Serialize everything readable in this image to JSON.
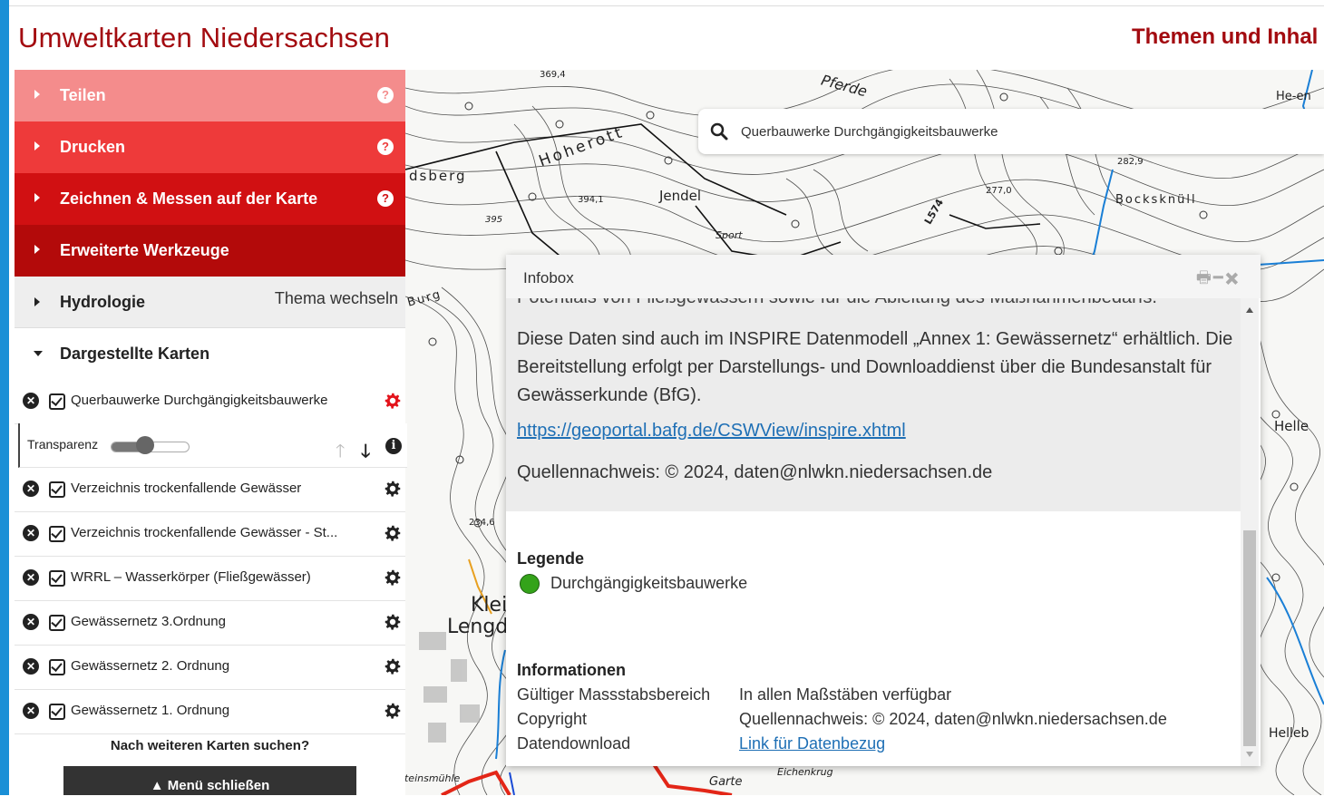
{
  "app": {
    "title": "Umweltkarten Niedersachsen",
    "themes_link": "Themen und Inhal"
  },
  "search": {
    "value": "Querbauwerke Durchgängigkeitsbauwerke"
  },
  "sidebar": {
    "menu": [
      {
        "label": "Teilen",
        "color": "#f48c8c"
      },
      {
        "label": "Drucken",
        "color": "#ee3a3a"
      },
      {
        "label": "Zeichnen & Messen auf der Karte",
        "color": "#d11012"
      },
      {
        "label": "Erweiterte Werkzeuge",
        "color": "#b30a0a"
      }
    ],
    "help_glyph": "?",
    "theme": {
      "label": "Hydrologie",
      "switch_label": "Thema wechseln"
    },
    "displayed_maps": {
      "label": "Dargestellte Karten"
    },
    "layers": [
      {
        "name": "Querbauwerke Durchgängigkeitsbauwerke",
        "gear_color": "#e3131b"
      },
      {
        "name": "Verzeichnis trockenfallende Gewässer",
        "gear_color": "#222222"
      },
      {
        "name": "Verzeichnis trockenfallende Gewässer - St...",
        "gear_color": "#222222"
      },
      {
        "name": "WRRL – Wasserkörper (Fließgewässer)",
        "gear_color": "#222222"
      },
      {
        "name": "Gewässernetz 3.Ordnung",
        "gear_color": "#222222"
      },
      {
        "name": "Gewässernetz 2. Ordnung",
        "gear_color": "#222222"
      },
      {
        "name": "Gewässernetz 1. Ordnung",
        "gear_color": "#222222"
      }
    ],
    "transparency": {
      "label": "Transparenz",
      "value_fraction": 0.45
    },
    "more_maps": "Nach weiteren Karten suchen?",
    "close_menu": "▲  Menü schließen"
  },
  "map_labels": {
    "l1": "Pferde",
    "l2": "Hoherott",
    "l3": "dsberg",
    "l4": "Jendel",
    "l5": "Bocksknüll",
    "l6": "Sport",
    "l7": "L574",
    "l8": "277,0",
    "l9": "282,9",
    "l10": "369,4",
    "l11": "394,1",
    "l12": "395",
    "l13": "Helle",
    "l14": "Klei",
    "l15": "Lengd",
    "l16": "234,6",
    "l17": "Steinsmühle",
    "l18": "Eichenkrug",
    "l19": "Garte",
    "l20": "Helleb",
    "l21": "Burg",
    "l22": "He-en"
  },
  "infobox": {
    "title": "Infobox",
    "cut_line": "Potentials von Fließgewässern sowie für die Ableitung des Maßnahmenbedarfs.",
    "paragraph": "Diese Daten sind auch im INSPIRE Datenmodell „Annex 1: Gewässernetz“ erhältlich. Die Bereitstellung erfolgt per Darstellungs- und Downloaddienst über die Bundesanstalt für Gewässerkunde (BfG).",
    "link": "https://geoportal.bafg.de/CSWView/inspire.xhtml",
    "source": "Quellennachweis: © 2024, daten@nlwkn.niedersachsen.de",
    "legend_heading": "Legende",
    "legend_item": "Durchgängigkeitsbauwerke",
    "legend_color": "#34a31a",
    "info_heading": "Informationen",
    "info_rows": [
      {
        "key": "Gültiger Massstabsbereich",
        "value": "In allen Maßstäben verfügbar"
      },
      {
        "key": "Copyright",
        "value": "Quellennachweis: © 2024, daten@nlwkn.niedersachsen.de"
      },
      {
        "key": "Datendownload",
        "value": "Link für Datenbezug"
      }
    ]
  }
}
